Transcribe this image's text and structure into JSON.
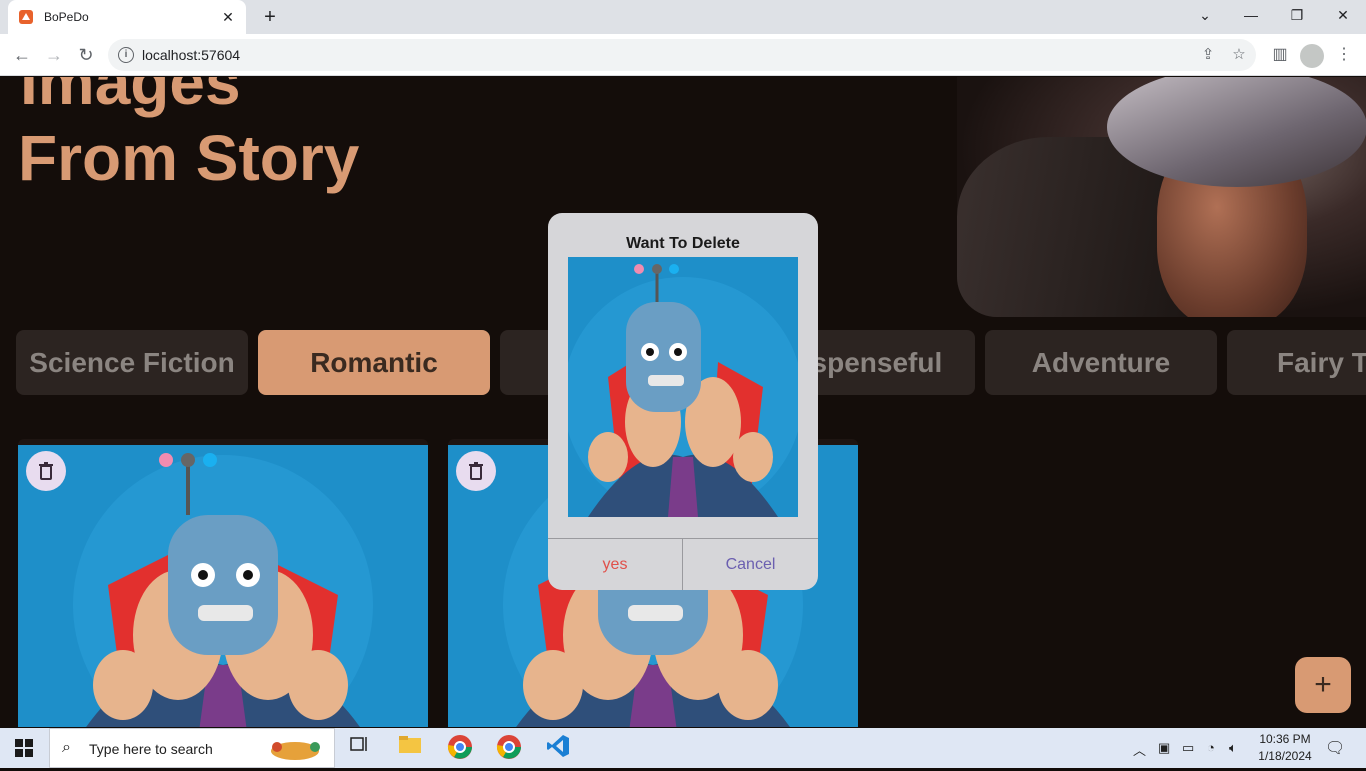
{
  "browser": {
    "tab_title": "BoPeDo",
    "url": "localhost:57604",
    "new_tab_label": "+",
    "tab_close_label": "✕",
    "window_controls": [
      "⌄",
      "—",
      "❐",
      "✕"
    ]
  },
  "page": {
    "heading_line1": "Images",
    "heading_line2": "From Story",
    "categories": [
      {
        "label": "Science Fiction",
        "active": false
      },
      {
        "label": "Romantic",
        "active": true
      },
      {
        "label": "Suspenseful",
        "active": false
      },
      {
        "label": "Adventure",
        "active": false
      },
      {
        "label": "Fairy Ta",
        "active": false
      }
    ],
    "fab_label": "+"
  },
  "dialog": {
    "title": "Want To Delete",
    "yes_label": "yes",
    "cancel_label": "Cancel"
  },
  "taskbar": {
    "search_placeholder": "Type here to search",
    "time": "10:36 PM",
    "date": "1/18/2024"
  },
  "colors": {
    "accent": "#d89a73",
    "page_bg": "#140d0a",
    "chip_bg": "#2c2421",
    "yes_red": "#e0504a",
    "cancel_purple": "#6b5fb0"
  }
}
